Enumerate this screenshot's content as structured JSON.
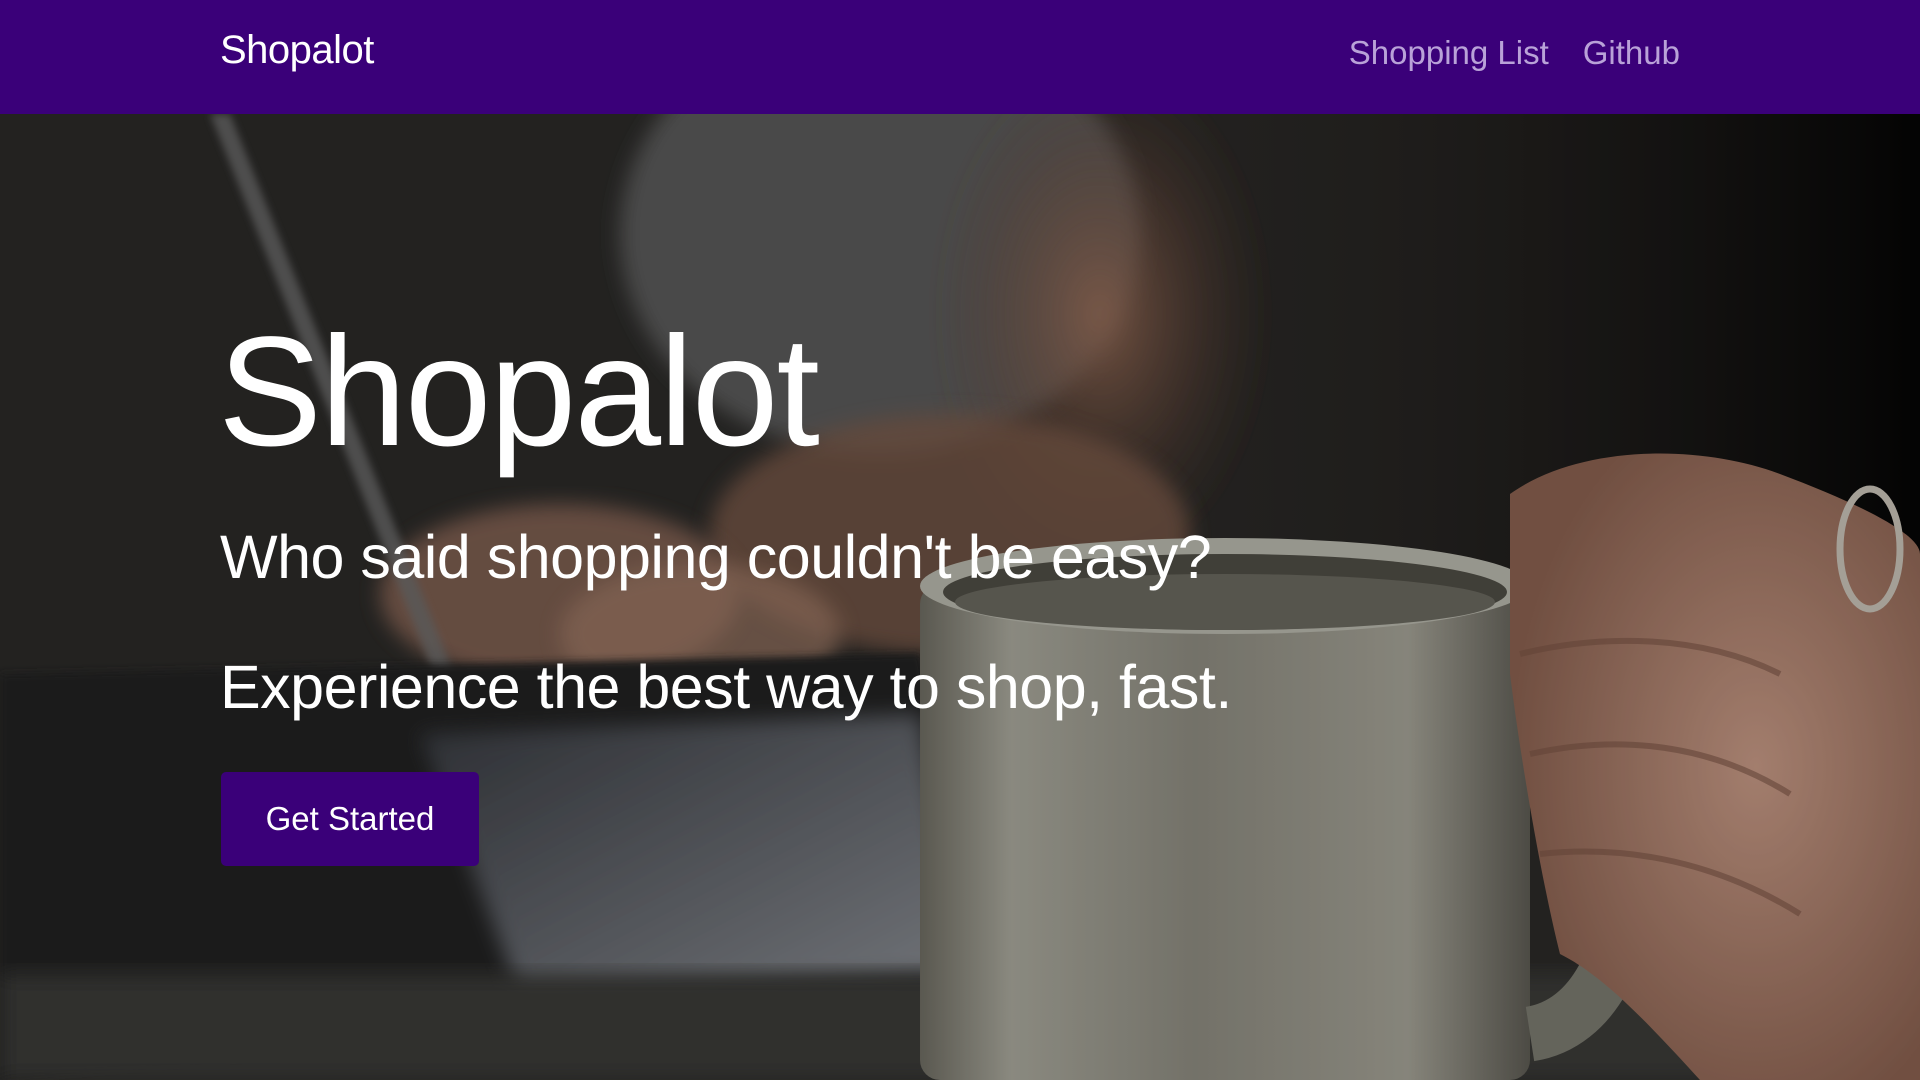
{
  "navbar": {
    "brand": "Shopalot",
    "links": [
      "Shopping List",
      "Github"
    ]
  },
  "hero": {
    "title": "Shopalot",
    "subtitle": "Who said shopping couldn't be easy?",
    "tagline": "Experience the best way to shop, fast.",
    "cta_label": "Get Started"
  },
  "colors": {
    "navbar_bg": "#3a0079",
    "nav_link": "#b9a2d8",
    "button_bg": "#3a0079",
    "text": "#ffffff"
  }
}
